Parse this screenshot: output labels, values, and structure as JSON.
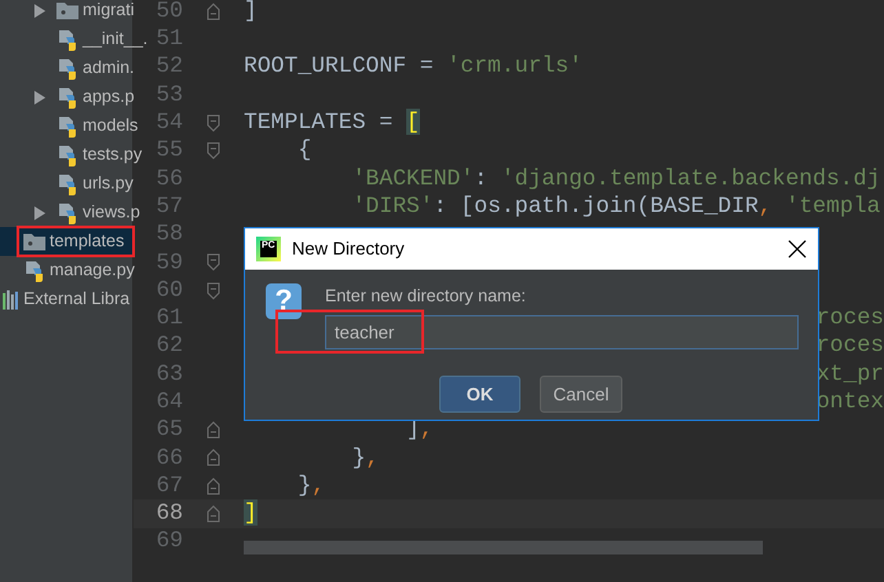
{
  "project_tree": [
    {
      "children": [
        {
          "children": [
            {
              "label": "migrati",
              "kind": "folder",
              "expandable": true,
              "selected": false
            },
            {
              "label": "__init__.",
              "kind": "python",
              "expandable": false,
              "selected": false
            },
            {
              "label": "admin.",
              "kind": "python",
              "expandable": false,
              "selected": false
            },
            {
              "label": "apps.p",
              "kind": "python",
              "expandable": true,
              "selected": false
            },
            {
              "label": "models",
              "kind": "python",
              "expandable": false,
              "selected": false
            },
            {
              "label": "tests.py",
              "kind": "python",
              "expandable": false,
              "selected": false
            },
            {
              "label": "urls.py",
              "kind": "python",
              "expandable": false,
              "selected": false
            },
            {
              "label": "views.p",
              "kind": "python",
              "expandable": true,
              "selected": false
            }
          ]
        },
        {
          "label": "templates",
          "kind": "folder",
          "selected": true,
          "annotated": true
        },
        {
          "label": "manage.py",
          "kind": "python",
          "selected": false
        }
      ]
    },
    {
      "label": "External Libra",
      "kind": "library",
      "selected": false
    }
  ],
  "editor": {
    "lines": [
      {
        "number": "50",
        "kind": "fold-end",
        "current": false,
        "tokens": [
          {
            "text": "]",
            "kind": "plain"
          }
        ]
      },
      {
        "number": "51",
        "kind": "plain",
        "current": false
      },
      {
        "number": "52",
        "kind": "plain",
        "current": false,
        "tokens": [
          {
            "text": "ROOT_URLCONF = ",
            "kind": "plain"
          },
          {
            "text": "'crm.urls'",
            "kind": "string"
          }
        ]
      },
      {
        "number": "53",
        "kind": "plain",
        "current": false
      },
      {
        "number": "54",
        "kind": "fold-start",
        "current": false,
        "tokens": [
          {
            "text": "TEMPLATES = ",
            "kind": "plain"
          },
          {
            "text": "[",
            "kind": "matched-bracket"
          }
        ]
      },
      {
        "number": "55",
        "kind": "fold-start",
        "current": false,
        "tokens": [
          {
            "text": "    {",
            "kind": "plain"
          }
        ]
      },
      {
        "number": "56",
        "kind": "plain",
        "current": false,
        "tokens": [
          {
            "text": "        'BACKEND'",
            "kind": "string"
          },
          {
            "text": ": ",
            "kind": "plain"
          },
          {
            "text": "'django.template.backends.dj",
            "kind": "string"
          }
        ]
      },
      {
        "number": "57",
        "kind": "plain",
        "current": false,
        "tokens": [
          {
            "text": "        'DIRS'",
            "kind": "string"
          },
          {
            "text": ": [os.path.join(BASE_DIR",
            "kind": "plain"
          },
          {
            "text": ",",
            "kind": "keyword"
          },
          {
            "text": " 'templa",
            "kind": "string"
          }
        ]
      },
      {
        "number": "58",
        "kind": "plain",
        "current": false
      },
      {
        "number": "59",
        "kind": "fold-start",
        "current": false
      },
      {
        "number": "60",
        "kind": "fold-start",
        "current": false
      },
      {
        "number": "61",
        "kind": "tail",
        "current": false,
        "tokens": [
          {
            "text": "roces",
            "kind": "string"
          }
        ]
      },
      {
        "number": "62",
        "kind": "tail",
        "current": false,
        "tokens": [
          {
            "text": "roces",
            "kind": "string"
          }
        ]
      },
      {
        "number": "63",
        "kind": "tail",
        "current": false,
        "tokens": [
          {
            "text": "xt_pr",
            "kind": "string"
          }
        ]
      },
      {
        "number": "64",
        "kind": "tail",
        "current": false,
        "tokens": [
          {
            "text": "ontex",
            "kind": "string"
          }
        ]
      },
      {
        "number": "65",
        "kind": "fold-end",
        "current": false,
        "tokens": [
          {
            "text": "            ]",
            "kind": "plain"
          },
          {
            "text": ",",
            "kind": "keyword"
          }
        ]
      },
      {
        "number": "66",
        "kind": "fold-end",
        "current": false,
        "tokens": [
          {
            "text": "        }",
            "kind": "plain"
          },
          {
            "text": ",",
            "kind": "keyword"
          }
        ]
      },
      {
        "number": "67",
        "kind": "fold-end",
        "current": false,
        "tokens": [
          {
            "text": "    }",
            "kind": "plain"
          },
          {
            "text": ",",
            "kind": "keyword"
          }
        ]
      },
      {
        "number": "68",
        "kind": "fold-end",
        "current": true,
        "tokens": [
          {
            "text": "]",
            "kind": "matched-bracket"
          }
        ]
      },
      {
        "number": "69",
        "kind": "plain",
        "current": false
      }
    ]
  },
  "dialog": {
    "logo_text": "PC",
    "title": "New Directory",
    "icon_glyph": "?",
    "prompt": "Enter new directory name:",
    "field": {
      "value": "teacher",
      "annotated": true
    },
    "buttons": [
      {
        "label": "OK",
        "default": true
      },
      {
        "label": "Cancel",
        "default": false
      }
    ]
  }
}
